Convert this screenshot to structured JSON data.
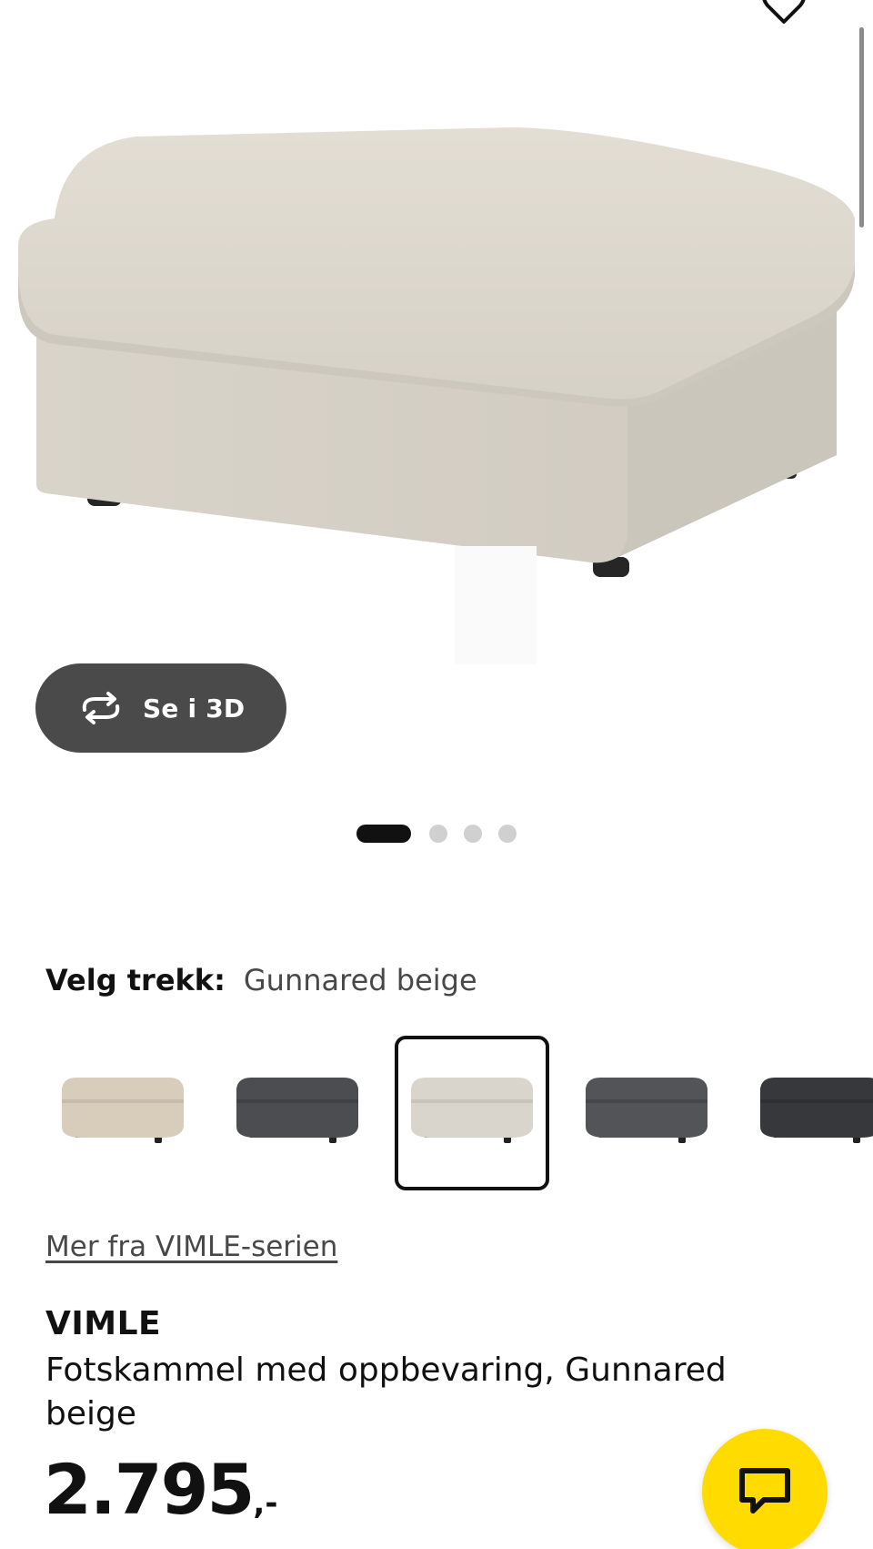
{
  "colors": {
    "pill_bg": "#4a4a4a",
    "chat_button": "#ffdb00",
    "text_primary": "#111111",
    "text_secondary": "#484848",
    "dot_inactive": "#d0d0d0",
    "dot_active": "#111111"
  },
  "hero": {
    "image": "footstool-gunnared-beige",
    "wishlist_icon": "heart-icon",
    "view_3d": {
      "icon": "rotate-3d-icon",
      "label": "Se i 3D"
    },
    "carousel": {
      "count": 4,
      "active_index": 0
    }
  },
  "variant": {
    "title": "Velg trekk:",
    "selected_value": "Gunnared beige",
    "swatches": [
      {
        "color": "#d8ccbb"
      },
      {
        "color": "#4b4d50"
      },
      {
        "color": "#d9d5cc",
        "selected": true
      },
      {
        "color": "#525458"
      },
      {
        "color": "#36383b"
      }
    ]
  },
  "series_link": "Mer fra VIMLE-serien",
  "product": {
    "name": "VIMLE",
    "description": "Fotskammel med oppbevaring, Gunnared beige"
  },
  "price": {
    "amount": "2.795",
    "suffix": ",-"
  },
  "chat": {
    "icon": "chat-icon"
  }
}
